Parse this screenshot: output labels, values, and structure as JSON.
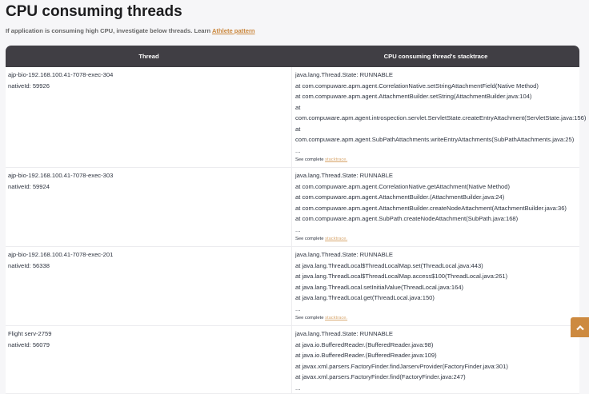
{
  "title": "CPU consuming threads",
  "subtitle": {
    "text": "If application is consuming high CPU, investigate below threads. Learn ",
    "link": "Athlete pattern"
  },
  "table": {
    "headers": [
      "Thread",
      "CPU consuming thread's stacktrace"
    ],
    "see_complete": "See complete ",
    "see_link": "stacktrace.",
    "rows": [
      {
        "thread": "ajp-bio-192.168.100.41-7078-exec-304",
        "native_id": "nativeId: 59926",
        "trace": [
          "java.lang.Thread.State: RUNNABLE",
          "at com.compuware.apm.agent.CorrelationNative.setStringAttachmentField(Native Method)",
          "at com.compuware.apm.agent.AttachmentBuilder.setString(AttachmentBuilder.java:104)",
          "at com.compuware.apm.agent.introspection.servlet.ServletState.createEntryAttachment(ServletState.java:156)",
          "at com.compuware.apm.agent.SubPathAttachments.writeEntryAttachments(SubPathAttachments.java:25)",
          "..."
        ],
        "see": true
      },
      {
        "thread": "ajp-bio-192.168.100.41-7078-exec-303",
        "native_id": "nativeId: 59924",
        "trace": [
          "java.lang.Thread.State: RUNNABLE",
          "at com.compuware.apm.agent.CorrelationNative.getAttachment(Native Method)",
          "at com.compuware.apm.agent.AttachmentBuilder.(AttachmentBuilder.java:24)",
          "at com.compuware.apm.agent.AttachmentBuilder.createNodeAttachment(AttachmentBuilder.java:36)",
          "at com.compuware.apm.agent.SubPath.createNodeAttachment(SubPath.java:168)",
          "..."
        ],
        "see": true
      },
      {
        "thread": "ajp-bio-192.168.100.41-7078-exec-201",
        "native_id": "nativeId: 56338",
        "trace": [
          "java.lang.Thread.State: RUNNABLE",
          "at java.lang.ThreadLocal$ThreadLocalMap.set(ThreadLocal.java:443)",
          "at java.lang.ThreadLocal$ThreadLocalMap.access$100(ThreadLocal.java:261)",
          "at java.lang.ThreadLocal.setInitialValue(ThreadLocal.java:164)",
          "at java.lang.ThreadLocal.get(ThreadLocal.java:150)",
          "..."
        ],
        "see": true
      },
      {
        "thread": "Flight serv-2759",
        "native_id": "nativeId: 56079",
        "trace": [
          "java.lang.Thread.State: RUNNABLE",
          "at java.io.BufferedReader.(BufferedReader.java:98)",
          "at java.io.BufferedReader.(BufferedReader.java:109)",
          "at javax.xml.parsers.FactoryFinder.findJarservProvider(FactoryFinder.java:301)",
          "at javax.xml.parsers.FactoryFinder.find(FactoryFinder.java:247)",
          "..."
        ],
        "see": false
      }
    ]
  },
  "scroll_top_icon": "chevron-up-icon",
  "colors": {
    "header_bg": "#403e44",
    "accent": "#cd8a40"
  }
}
